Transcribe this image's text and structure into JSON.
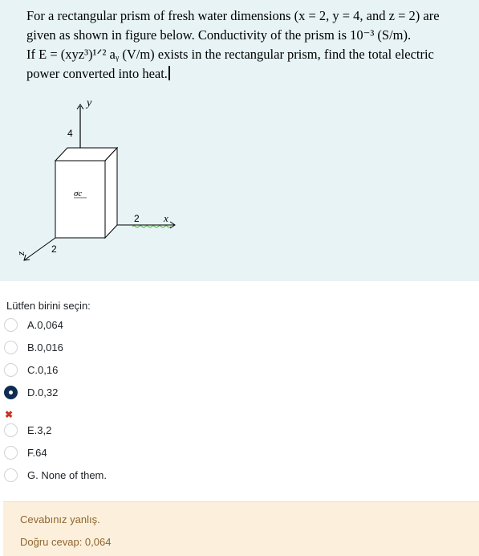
{
  "question": {
    "lines": [
      "For a rectangular prism of fresh water dimensions (x = 2, y = 4, and z = 2) are",
      "given as shown in figure below. Conductivity of the prism is 10⁻³ (S/m).",
      "If E = (xyz³)¹ᐟ² aᵧ (V/m) exists in the rectangular prism, find the total electric",
      "power converted into heat."
    ]
  },
  "figure": {
    "y_axis_label": "y",
    "x_axis_label": "x",
    "z_axis_label": "z",
    "y_dim": "4",
    "x_dim": "2",
    "z_dim": "2",
    "center_label": "σc"
  },
  "prompt": "Lütfen birini seçin:",
  "options": [
    {
      "label": "A.0,064",
      "checked": false
    },
    {
      "label": "B.0,016",
      "checked": false
    },
    {
      "label": "C.0,16",
      "checked": false
    },
    {
      "label": "D.0,32",
      "checked": true
    },
    {
      "label": "E.3,2",
      "checked": false
    },
    {
      "label": "F.64",
      "checked": false
    },
    {
      "label": "G.  None of them.",
      "checked": false
    }
  ],
  "wrong_icon": "cross-icon",
  "wrong_glyph": "✖",
  "feedback": {
    "result": "Cevabınız yanlış.",
    "correct": "Doğru cevap: 0,064"
  },
  "colors": {
    "question_bg": "#e7f3f5",
    "feedback_bg": "#fcefdc",
    "selected_radio": "#0f2d52",
    "wrong": "#ca3120"
  }
}
